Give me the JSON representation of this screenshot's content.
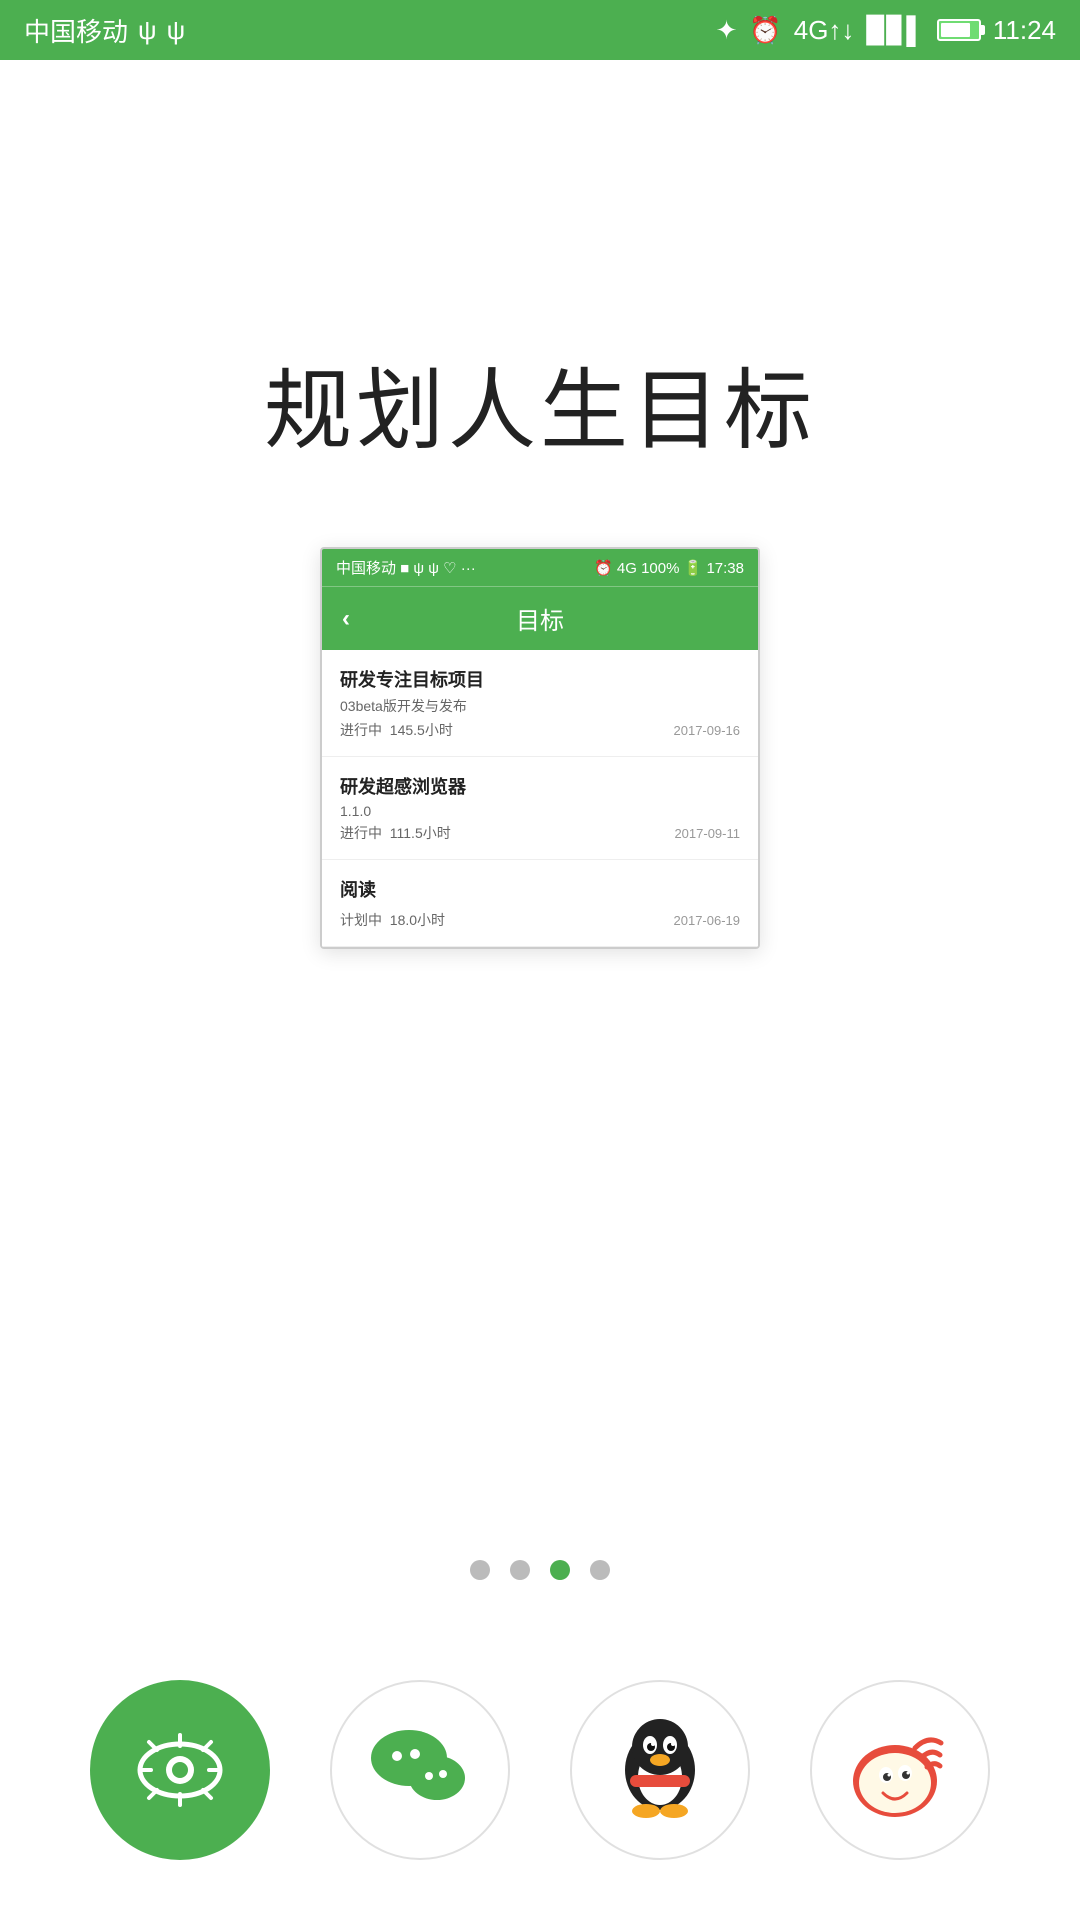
{
  "statusBar": {
    "carrier": "中国移动",
    "time": "11:24",
    "icons": {
      "usb1": "ψ",
      "usb2": "ψ",
      "bluetooth": "✦",
      "alarm": "⏰",
      "signal": "4G"
    }
  },
  "page": {
    "title": "规划人生目标"
  },
  "phoneCard": {
    "statusBar": {
      "left": "中国移动  ■ ψ ψ ♡ ···",
      "right": "⏰ 4G 100% 🔋 17:38"
    },
    "header": {
      "backIcon": "‹",
      "title": "目标"
    },
    "goals": [
      {
        "title": "研发专注目标项目",
        "sub": "03beta版开发与发布",
        "status": "进行中   145.5小时",
        "date": "2017-09-16"
      },
      {
        "title": "研发超感浏览器",
        "sub": "1.1.0",
        "status": "进行中   111.5小时",
        "date": "2017-09-11"
      },
      {
        "title": "阅读",
        "sub": "",
        "status": "计划中   18.0小时",
        "date": "2017-06-19"
      }
    ]
  },
  "pagination": {
    "dots": [
      {
        "active": false
      },
      {
        "active": false
      },
      {
        "active": true
      },
      {
        "active": false
      }
    ]
  },
  "bottomIcons": [
    {
      "name": "app-icon",
      "label": "绿眼",
      "style": "green"
    },
    {
      "name": "wechat-icon",
      "label": "微信",
      "style": "outline"
    },
    {
      "name": "qq-icon",
      "label": "QQ",
      "style": "outline"
    },
    {
      "name": "weibo-icon",
      "label": "微博",
      "style": "outline"
    }
  ]
}
